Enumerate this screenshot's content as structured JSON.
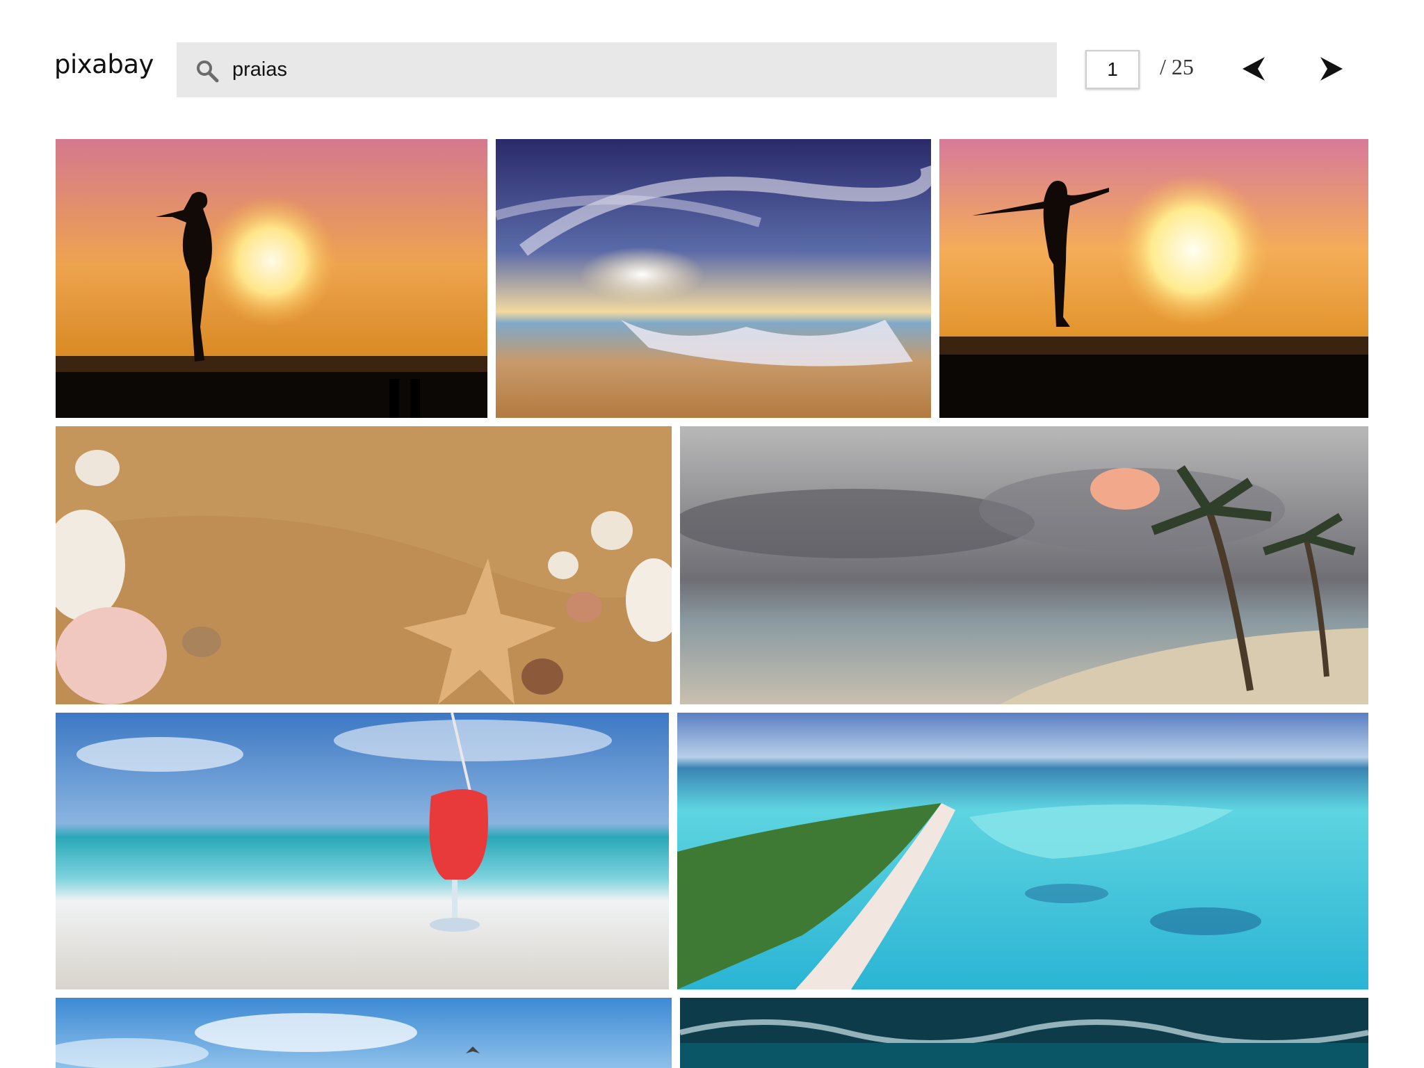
{
  "header": {
    "logo_text": "pixabay",
    "search": {
      "value": "praias",
      "icon": "search-icon"
    },
    "pagination": {
      "current_page": "1",
      "total_label": "/ 25",
      "prev_icon": "chevron-left-icon",
      "next_icon": "chevron-right-icon"
    }
  },
  "results": {
    "images": [
      {
        "subject": "woman-silhouette-sunset-pier"
      },
      {
        "subject": "beach-sunset-waves-dramatic-sky"
      },
      {
        "subject": "woman-arms-outstretched-sunset-pier"
      },
      {
        "subject": "seashells-and-starfish-on-sand"
      },
      {
        "subject": "stormy-clouds-beach-palm-trees"
      },
      {
        "subject": "red-cocktail-on-beach"
      },
      {
        "subject": "aerial-tropical-island-turquoise-lagoon"
      },
      {
        "subject": "blue-sky-beach-seagull"
      },
      {
        "subject": "ocean-waves-deep-blue"
      }
    ]
  },
  "colors": {
    "search_bg": "#e8e8e8",
    "text": "#111111"
  }
}
